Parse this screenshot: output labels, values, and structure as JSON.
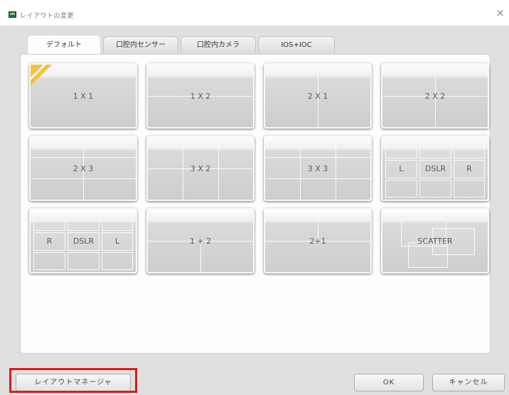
{
  "window": {
    "title": "レイアウトの変更",
    "close_glyph": "×"
  },
  "tabs": [
    {
      "label": "デフォルト",
      "active": true
    },
    {
      "label": "口腔内センサー",
      "active": false
    },
    {
      "label": "口腔内カメラ",
      "active": false
    },
    {
      "label": "IOS+IOC",
      "active": false
    }
  ],
  "layouts": [
    {
      "label": "1 X 1",
      "selected": true
    },
    {
      "label": "1 X 2"
    },
    {
      "label": "2 X 1"
    },
    {
      "label": "2 X 2"
    },
    {
      "label": "2 X 3"
    },
    {
      "label": "3 X 2"
    },
    {
      "label": "3 X 3"
    },
    {
      "label": "L DSLR R",
      "cells": [
        "L",
        "DSLR",
        "R"
      ]
    },
    {
      "label": "R DSLR L",
      "cells": [
        "R",
        "DSLR",
        "L"
      ]
    },
    {
      "label": "1 + 2"
    },
    {
      "label": "2+1"
    },
    {
      "label": "SCATTER"
    }
  ],
  "buttons": {
    "layout_manager": "レイアウトマネージャ",
    "ok": "OK",
    "cancel": "キャンセル"
  },
  "colors": {
    "selected_corner": "#f4c13b",
    "highlight_border": "#e0181c"
  }
}
